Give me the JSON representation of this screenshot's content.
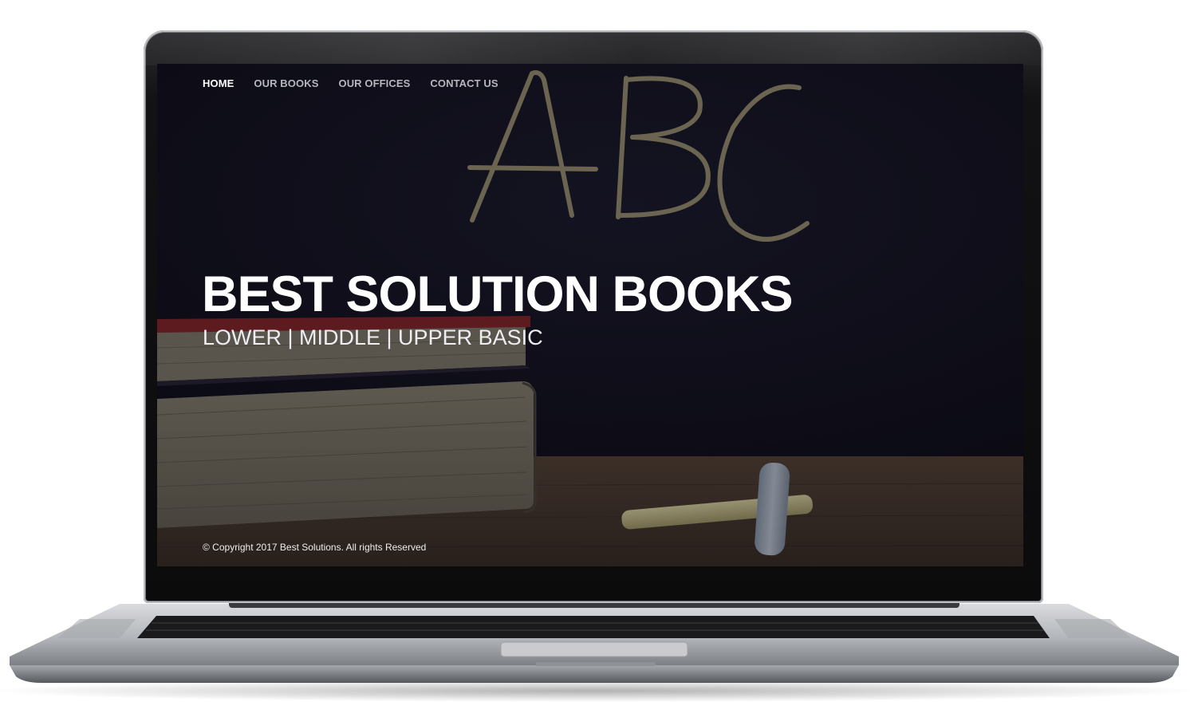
{
  "nav": {
    "items": [
      {
        "label": "HOME",
        "active": true
      },
      {
        "label": "OUR BOOKS",
        "active": false
      },
      {
        "label": "OUR OFFICES",
        "active": false
      },
      {
        "label": "CONTACT US",
        "active": false
      }
    ]
  },
  "hero": {
    "title": "BEST SOLUTION BOOKS",
    "subtitle": "LOWER | MIDDLE | UPPER BASIC",
    "background_image": "chalkboard-abc-books-chalk"
  },
  "footer": {
    "copyright": "© Copyright 2017 Best Solutions. All rights Reserved"
  },
  "colors": {
    "chalkboard": "#15131f",
    "text_primary": "#ffffff",
    "nav_inactive": "#b7b6bd",
    "book_red": "#b52a2c",
    "desk_wood": "#4a3a2b",
    "laptop_silver": "#b9bcc0"
  }
}
